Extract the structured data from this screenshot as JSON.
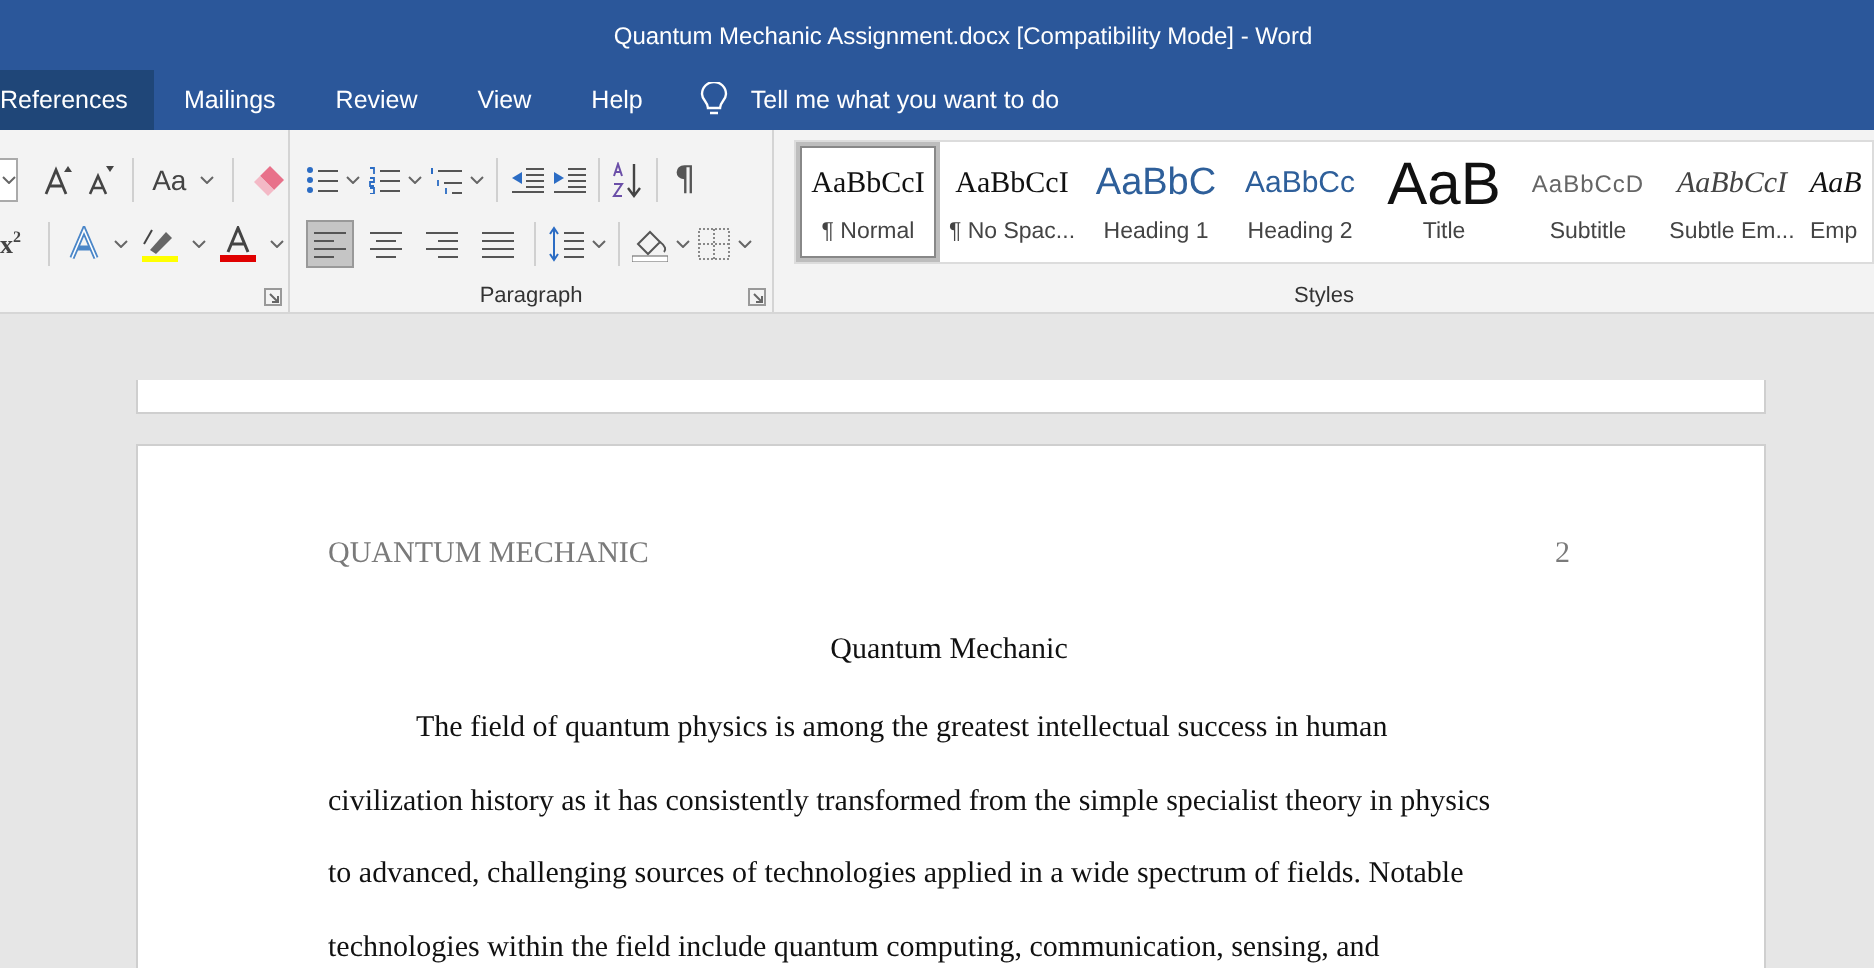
{
  "window": {
    "title": "Quantum Mechanic Assignment.docx [Compatibility Mode]  -  Word"
  },
  "tabs": [
    {
      "label": "References",
      "selected": true
    },
    {
      "label": "Mailings",
      "selected": false
    },
    {
      "label": "Review",
      "selected": false
    },
    {
      "label": "View",
      "selected": false
    },
    {
      "label": "Help",
      "selected": false
    }
  ],
  "tell_me": {
    "placeholder": "Tell me what you want to do"
  },
  "font_group": {
    "change_case": "Aa",
    "superscript": "x$^{2}$"
  },
  "paragraph_group": {
    "label": "Paragraph",
    "show_marks": "¶",
    "alignments": [
      {
        "kind": "left",
        "selected": true
      },
      {
        "kind": "center",
        "selected": false
      },
      {
        "kind": "right",
        "selected": false
      },
      {
        "kind": "justify",
        "selected": false
      }
    ]
  },
  "styles_group": {
    "label": "Styles",
    "items": [
      {
        "kind": "normal",
        "preview": "AaBbCcI",
        "name": "¶ Normal",
        "selected": true
      },
      {
        "kind": "nospacing",
        "preview": "AaBbCcI",
        "name": "¶ No Spac...",
        "selected": false
      },
      {
        "kind": "heading1",
        "preview": "AaBbC",
        "name": "Heading 1",
        "selected": false
      },
      {
        "kind": "heading2",
        "preview": "AaBbCc",
        "name": "Heading 2",
        "selected": false
      },
      {
        "kind": "title",
        "preview": "AaB",
        "name": "Title",
        "selected": false
      },
      {
        "kind": "subtitle",
        "preview": "AaBbCcD",
        "name": "Subtitle",
        "selected": false
      },
      {
        "kind": "subtle",
        "preview": "AaBbCcI",
        "name": "Subtle Em...",
        "selected": false
      },
      {
        "kind": "emphasis",
        "preview": "AaB",
        "name": "Emp",
        "selected": false
      }
    ]
  },
  "document": {
    "header": "QUANTUM MECHANIC",
    "page_number": "2",
    "title": "Quantum Mechanic",
    "paragraph_lines": [
      "The field of quantum physics is among the greatest intellectual success in human",
      "civilization history as it has consistently transformed from the simple specialist theory in physics",
      "to advanced, challenging sources of technologies applied in a wide spectrum of fields. Notable",
      "technologies within the field include quantum computing, communication, sensing, and"
    ]
  }
}
